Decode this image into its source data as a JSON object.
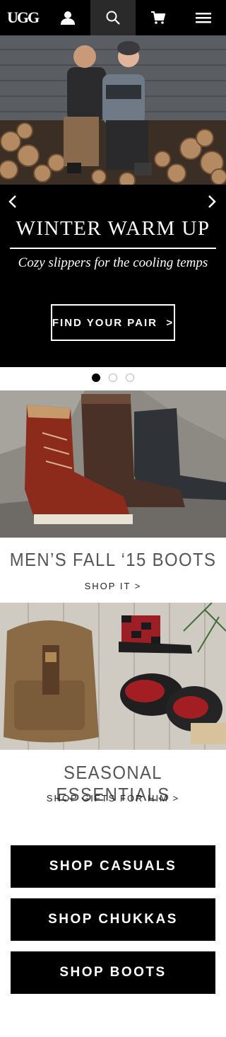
{
  "header": {
    "logo": "UGG",
    "icons": [
      "account-icon",
      "search-icon",
      "cart-icon",
      "menu-icon"
    ]
  },
  "hero": {
    "title": "WINTER WARM UP",
    "subtitle": "Cozy slippers for the cooling temps",
    "cta": "FIND YOUR PAIR  >",
    "slides_total": 3,
    "active_slide": 1
  },
  "promos": [
    {
      "title": "MEN’S FALL ‘15 BOOTS",
      "link": "SHOP IT >"
    },
    {
      "title": "SEASONAL ESSENTIALS",
      "link": "SHOP GIFTS FOR HIM >"
    }
  ],
  "shop_buttons": [
    "SHOP CASUALS",
    "SHOP CHUKKAS",
    "SHOP BOOTS"
  ]
}
